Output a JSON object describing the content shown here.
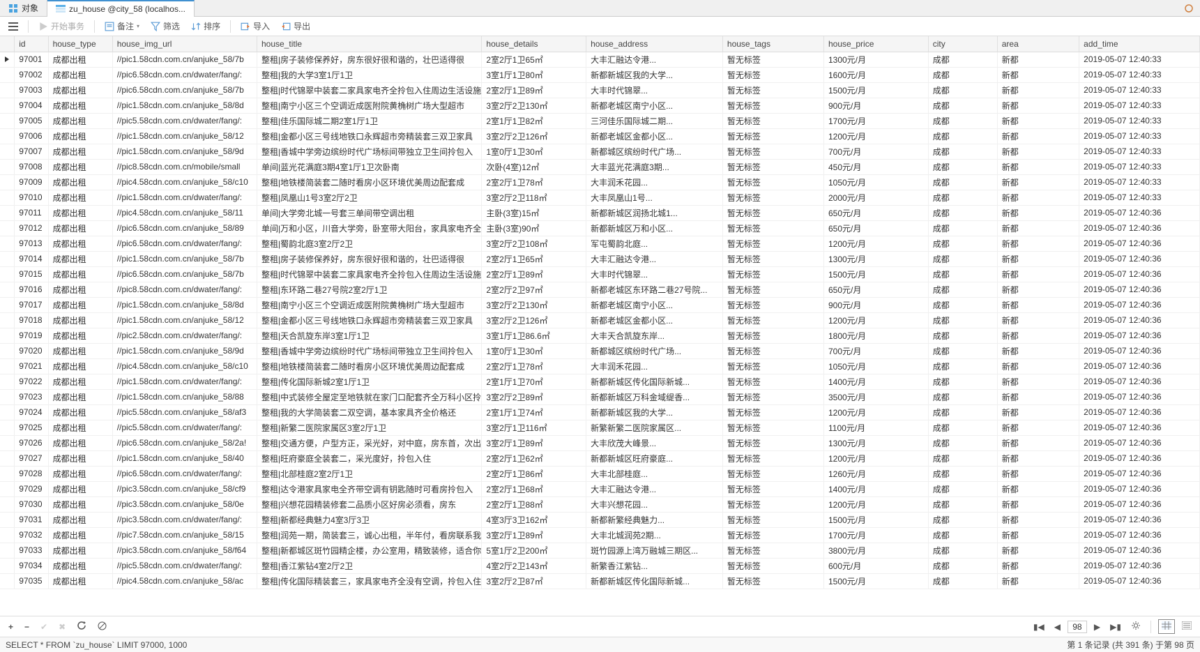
{
  "tabs": {
    "object": "对象",
    "active": "zu_house @city_58 (localhos..."
  },
  "toolbar": {
    "begin_tx": "开始事务",
    "memo": "备注",
    "filter": "筛选",
    "sort": "排序",
    "import": "导入",
    "export": "导出"
  },
  "columns": [
    "id",
    "house_type",
    "house_img_url",
    "house_title",
    "house_details",
    "house_address",
    "house_tags",
    "house_price",
    "city",
    "area",
    "add_time"
  ],
  "rows": [
    {
      "id": "97001",
      "type": "成都出租",
      "img": "//pic1.58cdn.com.cn/anjuke_58/7b",
      "title": "整租|房子装修保养好，房东很好很和谐的，壮巴适得很",
      "details": "2室2厅1卫65㎡",
      "addr": "大丰汇融达令港...",
      "tags": "暂无标签",
      "price": "1300元/月",
      "city": "成都",
      "area": "新都",
      "add": "2019-05-07 12:40:33"
    },
    {
      "id": "97002",
      "type": "成都出租",
      "img": "//pic6.58cdn.com.cn/dwater/fang/:",
      "title": "整租|我的大学3室1厅1卫",
      "details": "3室1厅1卫80㎡",
      "addr": "新都新城区我的大学...",
      "tags": "暂无标签",
      "price": "1600元/月",
      "city": "成都",
      "area": "新都",
      "add": "2019-05-07 12:40:33"
    },
    {
      "id": "97003",
      "type": "成都出租",
      "img": "//pic6.58cdn.com.cn/anjuke_58/7b",
      "title": "整租|时代锦翠中装套二家具家电齐全拎包入住周边生活设施",
      "details": "2室2厅1卫89㎡",
      "addr": "大丰时代锦翠...",
      "tags": "暂无标签",
      "price": "1500元/月",
      "city": "成都",
      "area": "新都",
      "add": "2019-05-07 12:40:33"
    },
    {
      "id": "97004",
      "type": "成都出租",
      "img": "//pic1.58cdn.com.cn/anjuke_58/8d",
      "title": "整租|南宁小区三个空调近成医附院黄桷树广场大型超市",
      "details": "3室2厅2卫130㎡",
      "addr": "新都老城区南宁小区...",
      "tags": "暂无标签",
      "price": "900元/月",
      "city": "成都",
      "area": "新都",
      "add": "2019-05-07 12:40:33"
    },
    {
      "id": "97005",
      "type": "成都出租",
      "img": "//pic5.58cdn.com.cn/dwater/fang/:",
      "title": "整租|佳乐国际城二期2室1厅1卫",
      "details": "2室1厅1卫82㎡",
      "addr": "三河佳乐国际城二期...",
      "tags": "暂无标签",
      "price": "1700元/月",
      "city": "成都",
      "area": "新都",
      "add": "2019-05-07 12:40:33"
    },
    {
      "id": "97006",
      "type": "成都出租",
      "img": "//pic1.58cdn.com.cn/anjuke_58/12",
      "title": "整租|金都小区三号线地铁口永辉超市旁精装套三双卫家具",
      "details": "3室2厅2卫126㎡",
      "addr": "新都老城区金都小区...",
      "tags": "暂无标签",
      "price": "1200元/月",
      "city": "成都",
      "area": "新都",
      "add": "2019-05-07 12:40:33"
    },
    {
      "id": "97007",
      "type": "成都出租",
      "img": "//pic1.58cdn.com.cn/anjuke_58/9d",
      "title": "整租|香城中学旁边缤纷时代广场标间带独立卫生间拎包入",
      "details": "1室0厅1卫30㎡",
      "addr": "新都城区缤纷时代广场...",
      "tags": "暂无标签",
      "price": "700元/月",
      "city": "成都",
      "area": "新都",
      "add": "2019-05-07 12:40:33"
    },
    {
      "id": "97008",
      "type": "成都出租",
      "img": "//pic8.58cdn.com.cn/mobile/small",
      "title": "单间|蓝光花满庭3期4室1厅1卫次卧南",
      "details": "次卧(4室)12㎡",
      "addr": "大丰蓝光花满庭3期...",
      "tags": "暂无标签",
      "price": "450元/月",
      "city": "成都",
      "area": "新都",
      "add": "2019-05-07 12:40:33"
    },
    {
      "id": "97009",
      "type": "成都出租",
      "img": "//pic4.58cdn.com.cn/anjuke_58/c10",
      "title": "整租|地铁楼简装套二随时看房小区环境优美周边配套成",
      "details": "2室2厅1卫78㎡",
      "addr": "大丰润禾花园...",
      "tags": "暂无标签",
      "price": "1050元/月",
      "city": "成都",
      "area": "新都",
      "add": "2019-05-07 12:40:33"
    },
    {
      "id": "97010",
      "type": "成都出租",
      "img": "//pic1.58cdn.com.cn/dwater/fang/:",
      "title": "整租|凤凰山1号3室2厅2卫",
      "details": "3室2厅2卫118㎡",
      "addr": "大丰凤凰山1号...",
      "tags": "暂无标签",
      "price": "2000元/月",
      "city": "成都",
      "area": "新都",
      "add": "2019-05-07 12:40:33"
    },
    {
      "id": "97011",
      "type": "成都出租",
      "img": "//pic4.58cdn.com.cn/anjuke_58/11",
      "title": "单间|大学旁北城一号套三单间带空调出租",
      "details": "主卧(3室)15㎡",
      "addr": "新都新城区润扬北城1...",
      "tags": "暂无标签",
      "price": "650元/月",
      "city": "成都",
      "area": "新都",
      "add": "2019-05-07 12:40:36"
    },
    {
      "id": "97012",
      "type": "成都出租",
      "img": "//pic6.58cdn.com.cn/anjuke_58/89",
      "title": "单间|万和小区，川音大学旁，卧室带大阳台，家具家电齐全",
      "details": "主卧(3室)90㎡",
      "addr": "新都新城区万和小区...",
      "tags": "暂无标签",
      "price": "650元/月",
      "city": "成都",
      "area": "新都",
      "add": "2019-05-07 12:40:36"
    },
    {
      "id": "97013",
      "type": "成都出租",
      "img": "//pic6.58cdn.com.cn/dwater/fang/:",
      "title": "整租|蜀韵北庭3室2厅2卫",
      "details": "3室2厅2卫108㎡",
      "addr": "军屯蜀韵北庭...",
      "tags": "暂无标签",
      "price": "1200元/月",
      "city": "成都",
      "area": "新都",
      "add": "2019-05-07 12:40:36"
    },
    {
      "id": "97014",
      "type": "成都出租",
      "img": "//pic1.58cdn.com.cn/anjuke_58/7b",
      "title": "整租|房子装修保养好，房东很好很和谐的，壮巴适得很",
      "details": "2室2厅1卫65㎡",
      "addr": "大丰汇融达令港...",
      "tags": "暂无标签",
      "price": "1300元/月",
      "city": "成都",
      "area": "新都",
      "add": "2019-05-07 12:40:36"
    },
    {
      "id": "97015",
      "type": "成都出租",
      "img": "//pic6.58cdn.com.cn/anjuke_58/7b",
      "title": "整租|时代锦翠中装套二家具家电齐全拎包入住周边生活设施",
      "details": "2室2厅1卫89㎡",
      "addr": "大丰时代锦翠...",
      "tags": "暂无标签",
      "price": "1500元/月",
      "city": "成都",
      "area": "新都",
      "add": "2019-05-07 12:40:36"
    },
    {
      "id": "97016",
      "type": "成都出租",
      "img": "//pic8.58cdn.com.cn/dwater/fang/:",
      "title": "整租|东环路二巷27号院2室2厅1卫",
      "details": "2室2厅2卫97㎡",
      "addr": "新都老城区东环路二巷27号院...",
      "tags": "暂无标签",
      "price": "650元/月",
      "city": "成都",
      "area": "新都",
      "add": "2019-05-07 12:40:36"
    },
    {
      "id": "97017",
      "type": "成都出租",
      "img": "//pic1.58cdn.com.cn/anjuke_58/8d",
      "title": "整租|南宁小区三个空调近成医附院黄桷树广场大型超市",
      "details": "3室2厅2卫130㎡",
      "addr": "新都老城区南宁小区...",
      "tags": "暂无标签",
      "price": "900元/月",
      "city": "成都",
      "area": "新都",
      "add": "2019-05-07 12:40:36"
    },
    {
      "id": "97018",
      "type": "成都出租",
      "img": "//pic1.58cdn.com.cn/anjuke_58/12",
      "title": "整租|金都小区三号线地铁口永辉超市旁精装套三双卫家具",
      "details": "3室2厅2卫126㎡",
      "addr": "新都老城区金都小区...",
      "tags": "暂无标签",
      "price": "1200元/月",
      "city": "成都",
      "area": "新都",
      "add": "2019-05-07 12:40:36"
    },
    {
      "id": "97019",
      "type": "成都出租",
      "img": "//pic2.58cdn.com.cn/dwater/fang/:",
      "title": "整租|天合凯旋东岸3室1厅1卫",
      "details": "3室1厅1卫86.6㎡",
      "addr": "大丰天合凯旋东岸...",
      "tags": "暂无标签",
      "price": "1800元/月",
      "city": "成都",
      "area": "新都",
      "add": "2019-05-07 12:40:36"
    },
    {
      "id": "97020",
      "type": "成都出租",
      "img": "//pic1.58cdn.com.cn/anjuke_58/9d",
      "title": "整租|香城中学旁边缤纷时代广场标间带独立卫生间拎包入",
      "details": "1室0厅1卫30㎡",
      "addr": "新都城区缤纷时代广场...",
      "tags": "暂无标签",
      "price": "700元/月",
      "city": "成都",
      "area": "新都",
      "add": "2019-05-07 12:40:36"
    },
    {
      "id": "97021",
      "type": "成都出租",
      "img": "//pic4.58cdn.com.cn/anjuke_58/c10",
      "title": "整租|地铁楼简装套二随时看房小区环境优美周边配套成",
      "details": "2室2厅1卫78㎡",
      "addr": "大丰润禾花园...",
      "tags": "暂无标签",
      "price": "1050元/月",
      "city": "成都",
      "area": "新都",
      "add": "2019-05-07 12:40:36"
    },
    {
      "id": "97022",
      "type": "成都出租",
      "img": "//pic1.58cdn.com.cn/dwater/fang/:",
      "title": "整租|传化国际新城2室1厅1卫",
      "details": "2室1厅1卫70㎡",
      "addr": "新都新城区传化国际新城...",
      "tags": "暂无标签",
      "price": "1400元/月",
      "city": "成都",
      "area": "新都",
      "add": "2019-05-07 12:40:36"
    },
    {
      "id": "97023",
      "type": "成都出租",
      "img": "//pic1.58cdn.com.cn/anjuke_58/88",
      "title": "整租|中式装修全屋定至地铁就在家门口配套齐全万科小区拎",
      "details": "3室2厅2卫89㎡",
      "addr": "新都新城区万科金域缇香...",
      "tags": "暂无标签",
      "price": "3500元/月",
      "city": "成都",
      "area": "新都",
      "add": "2019-05-07 12:40:36"
    },
    {
      "id": "97024",
      "type": "成都出租",
      "img": "//pic5.58cdn.com.cn/anjuke_58/af3",
      "title": "整租|我的大学简装套二双空调，基本家具齐全价格还",
      "details": "2室1厅1卫74㎡",
      "addr": "新都新城区我的大学...",
      "tags": "暂无标签",
      "price": "1200元/月",
      "city": "成都",
      "area": "新都",
      "add": "2019-05-07 12:40:36"
    },
    {
      "id": "97025",
      "type": "成都出租",
      "img": "//pic5.58cdn.com.cn/dwater/fang/:",
      "title": "整租|新繁二医院家属区3室2厅1卫",
      "details": "3室2厅1卫116㎡",
      "addr": "新繁新繁二医院家属区...",
      "tags": "暂无标签",
      "price": "1100元/月",
      "city": "成都",
      "area": "新都",
      "add": "2019-05-07 12:40:36"
    },
    {
      "id": "97026",
      "type": "成都出租",
      "img": "//pic6.58cdn.com.cn/anjuke_58/2a!",
      "title": "整租|交通方便，户型方正，采光好，对中庭，房东首，次出",
      "details": "3室2厅1卫89㎡",
      "addr": "大丰欣茂大峰景...",
      "tags": "暂无标签",
      "price": "1300元/月",
      "city": "成都",
      "area": "新都",
      "add": "2019-05-07 12:40:36"
    },
    {
      "id": "97027",
      "type": "成都出租",
      "img": "//pic1.58cdn.com.cn/anjuke_58/40",
      "title": "整租|旺府豪庭全装套二，采光度好，拎包入住",
      "details": "2室2厅1卫62㎡",
      "addr": "新都新城区旺府豪庭...",
      "tags": "暂无标签",
      "price": "1200元/月",
      "city": "成都",
      "area": "新都",
      "add": "2019-05-07 12:40:36"
    },
    {
      "id": "97028",
      "type": "成都出租",
      "img": "//pic6.58cdn.com.cn/dwater/fang/:",
      "title": "整租|北部桂庭2室2厅1卫",
      "details": "2室2厅1卫86㎡",
      "addr": "大丰北部桂庭...",
      "tags": "暂无标签",
      "price": "1260元/月",
      "city": "成都",
      "area": "新都",
      "add": "2019-05-07 12:40:36"
    },
    {
      "id": "97029",
      "type": "成都出租",
      "img": "//pic3.58cdn.com.cn/anjuke_58/cf9",
      "title": "整租|达令港家具家电全齐带空调有钥匙随时可看房拎包入",
      "details": "2室2厅1卫68㎡",
      "addr": "大丰汇融达令港...",
      "tags": "暂无标签",
      "price": "1400元/月",
      "city": "成都",
      "area": "新都",
      "add": "2019-05-07 12:40:36"
    },
    {
      "id": "97030",
      "type": "成都出租",
      "img": "//pic3.58cdn.com.cn/anjuke_58/0e",
      "title": "整租|兴想花园精装修套二品质小区好房必须看，房东",
      "details": "2室2厅1卫88㎡",
      "addr": "大丰兴想花园...",
      "tags": "暂无标签",
      "price": "1200元/月",
      "city": "成都",
      "area": "新都",
      "add": "2019-05-07 12:40:36"
    },
    {
      "id": "97031",
      "type": "成都出租",
      "img": "//pic3.58cdn.com.cn/dwater/fang/:",
      "title": "整租|新都经典魅力4室3厅3卫",
      "details": "4室3厅3卫162㎡",
      "addr": "新都新繁经典魅力...",
      "tags": "暂无标签",
      "price": "1500元/月",
      "city": "成都",
      "area": "新都",
      "add": "2019-05-07 12:40:36"
    },
    {
      "id": "97032",
      "type": "成都出租",
      "img": "//pic7.58cdn.com.cn/anjuke_58/15",
      "title": "整租|润苑一期，简装套三，诚心出租，半年付，看房联系我",
      "details": "3室2厅1卫89㎡",
      "addr": "大丰北城润苑2期...",
      "tags": "暂无标签",
      "price": "1700元/月",
      "city": "成都",
      "area": "新都",
      "add": "2019-05-07 12:40:36"
    },
    {
      "id": "97033",
      "type": "成都出租",
      "img": "//pic3.58cdn.com.cn/anjuke_58/f64",
      "title": "整租|新都城区斑竹园精企楼，办公室用，精致装修，适合你的",
      "details": "5室1厅2卫200㎡",
      "addr": "斑竹园源上湾万融城三期区...",
      "tags": "暂无标签",
      "price": "3800元/月",
      "city": "成都",
      "area": "新都",
      "add": "2019-05-07 12:40:36"
    },
    {
      "id": "97034",
      "type": "成都出租",
      "img": "//pic5.58cdn.com.cn/dwater/fang/:",
      "title": "整租|香江紫钻4室2厅2卫",
      "details": "4室2厅2卫143㎡",
      "addr": "新繁香江紫钻...",
      "tags": "暂无标签",
      "price": "600元/月",
      "city": "成都",
      "area": "新都",
      "add": "2019-05-07 12:40:36"
    },
    {
      "id": "97035",
      "type": "成都出租",
      "img": "//pic4.58cdn.com.cn/anjuke_58/ac",
      "title": "整租|传化国际精装套三，家具家电齐全没有空调，拎包入住",
      "details": "3室2厅2卫87㎡",
      "addr": "新都新城区传化国际新城...",
      "tags": "暂无标签",
      "price": "1500元/月",
      "city": "成都",
      "area": "新都",
      "add": "2019-05-07 12:40:36"
    }
  ],
  "footer": {
    "page": "98"
  },
  "status": {
    "sql": "SELECT * FROM `zu_house` LIMIT 97000, 1000",
    "summary": "第 1 条记录 (共 391 条) 于第 98 页"
  }
}
